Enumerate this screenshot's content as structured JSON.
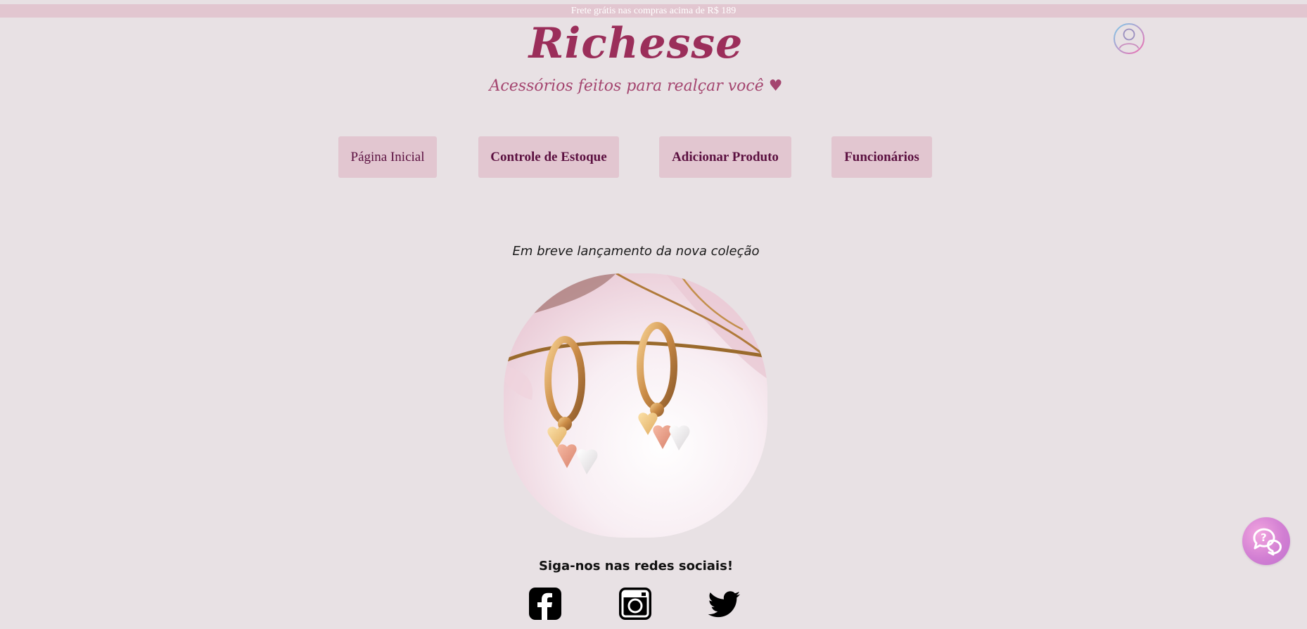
{
  "promo": {
    "text": "Frete grátis nas compras acima de R$ 189"
  },
  "brand": {
    "name": "Richesse",
    "tagline": "Acessórios feitos para realçar você ♥"
  },
  "header": {
    "user_icon": "user-circle-icon"
  },
  "nav": {
    "items": [
      {
        "label": "Página Inicial"
      },
      {
        "label": "Controle de Estoque"
      },
      {
        "label": "Adicionar Produto"
      },
      {
        "label": "Funcionários"
      }
    ]
  },
  "main": {
    "announcement": "Em breve lançamento da nova coleção",
    "hero_image": "gold-heart-hoop-earrings-photo"
  },
  "social": {
    "title": "Siga-nos nas redes sociais!",
    "icons": [
      "facebook-icon",
      "instagram-icon",
      "twitter-icon"
    ]
  },
  "help": {
    "icon": "help-chat-icon"
  },
  "colors": {
    "background": "#e8e1e4",
    "promo_bar": "#e2c6d0",
    "brand": "#9b2e5a",
    "nav_button": "#e2c6d0",
    "nav_text": "#5b1040"
  }
}
